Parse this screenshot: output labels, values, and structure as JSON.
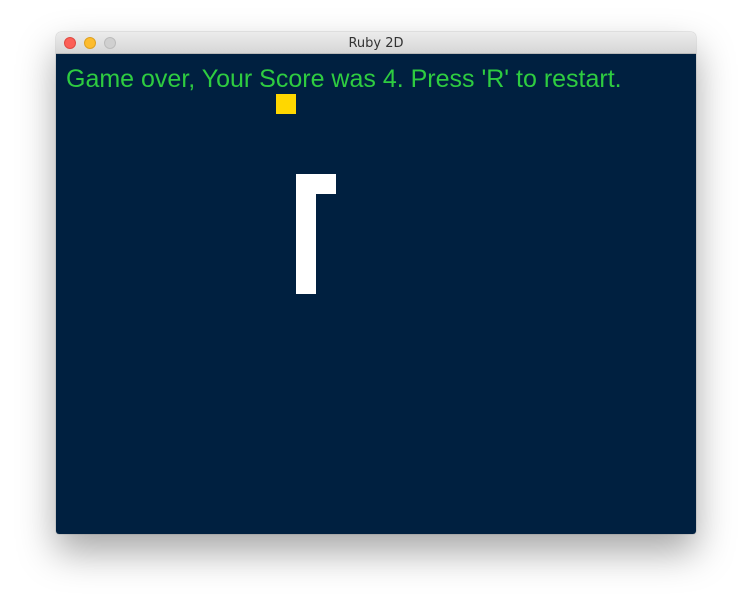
{
  "window": {
    "title": "Ruby 2D"
  },
  "game": {
    "message": "Game over, Your Score was 4. Press 'R' to restart.",
    "background_color": "#002040",
    "text_color": "#2ecc40",
    "food_color": "#ffd700",
    "snake_color": "#ffffff"
  }
}
